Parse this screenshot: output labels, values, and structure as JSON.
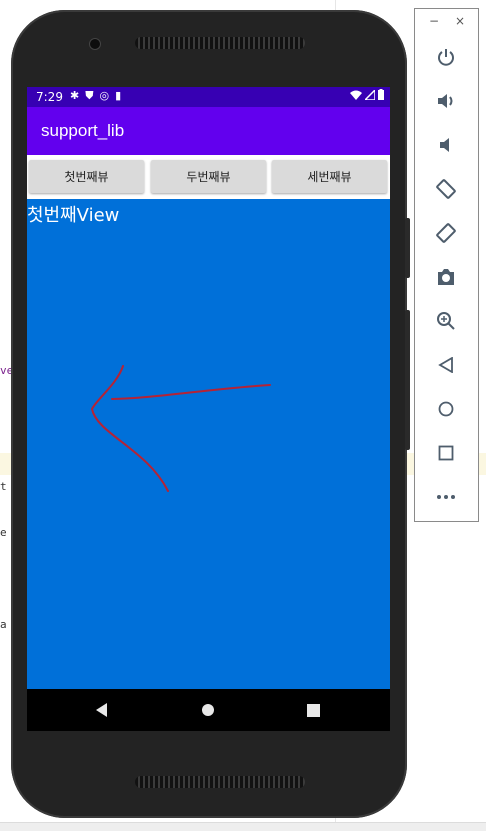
{
  "background": {
    "code_fragments": [
      "ve",
      "t",
      "e",
      "a"
    ]
  },
  "status_bar": {
    "time": "7:29",
    "icons_left": [
      "gear-icon",
      "shield-icon",
      "vpn-icon",
      "sd-card-icon"
    ],
    "icons_right": [
      "wifi-icon",
      "signal-icon",
      "battery-icon"
    ]
  },
  "app": {
    "title": "support_lib",
    "tabs": [
      {
        "label": "첫번째뷰"
      },
      {
        "label": "두번째뷰"
      },
      {
        "label": "세번째뷰"
      }
    ],
    "content_text": "첫번째View",
    "content_color": "#0070d9",
    "appbar_color": "#6200ee",
    "statusbar_color": "#3700b3"
  },
  "nav_bar": {
    "buttons": [
      "back-icon",
      "home-icon",
      "recents-icon"
    ]
  },
  "emulator_panel": {
    "window_buttons": [
      "minimize-icon",
      "close-icon"
    ],
    "tools": [
      "power-icon",
      "volume-up-icon",
      "volume-down-icon",
      "rotate-left-icon",
      "rotate-right-icon",
      "camera-icon",
      "zoom-icon",
      "back-icon",
      "home-icon",
      "overview-icon",
      "more-icon"
    ]
  }
}
